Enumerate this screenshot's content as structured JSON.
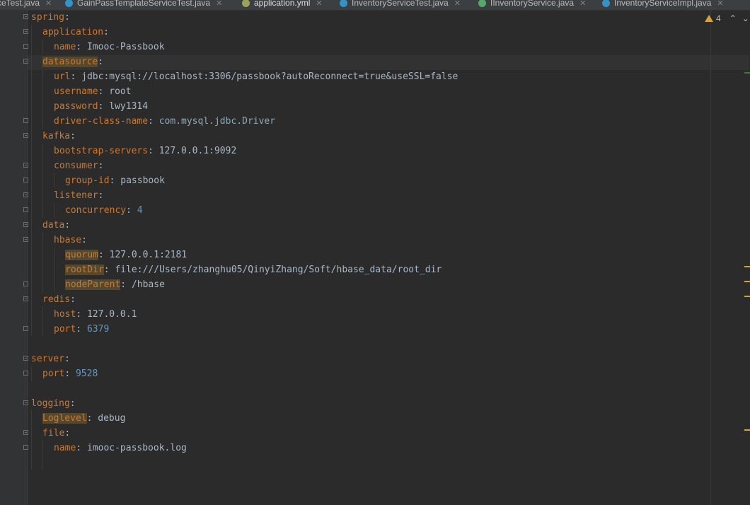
{
  "tabs": [
    {
      "label": "ceTest.java",
      "icon": "class-icon",
      "active": false
    },
    {
      "label": "GainPassTemplateServiceTest.java",
      "icon": "class-icon",
      "active": false
    },
    {
      "label": "application.yml",
      "icon": "yaml-icon",
      "active": true
    },
    {
      "label": "InventoryServiceTest.java",
      "icon": "class-icon",
      "active": false
    },
    {
      "label": "IInventoryService.java",
      "icon": "interface-icon",
      "active": false
    },
    {
      "label": "InventoryServiceImpl.java",
      "icon": "class-icon",
      "active": false
    }
  ],
  "inspection": {
    "count": "4",
    "up": "^",
    "down": "v"
  },
  "code": {
    "l1": {
      "k": "spring",
      "s": ":"
    },
    "l2": {
      "k": "application",
      "s": ":"
    },
    "l3": {
      "k": "name",
      "s": ": ",
      "v": "Imooc-Passbook"
    },
    "l4": {
      "k": "datasource",
      "s": ":"
    },
    "l5": {
      "k": "url",
      "s": ": ",
      "v": "jdbc:mysql://localhost:3306/passbook?autoReconnect=true&useSSL=false"
    },
    "l6": {
      "k": "username",
      "s": ": ",
      "v": "root"
    },
    "l7": {
      "k": "password",
      "s": ": ",
      "v": "lwy1314"
    },
    "l8": {
      "k": "driver-class-name",
      "s": ": ",
      "v": "com.mysql.jdbc.Driver"
    },
    "l9": {
      "k": "kafka",
      "s": ":"
    },
    "l10": {
      "k": "bootstrap-servers",
      "s": ": ",
      "v": "127.0.0.1:9092"
    },
    "l11": {
      "k": "consumer",
      "s": ":"
    },
    "l12": {
      "k": "group-id",
      "s": ": ",
      "v": "passbook"
    },
    "l13": {
      "k": "listener",
      "s": ":"
    },
    "l14": {
      "k": "concurrency",
      "s": ": ",
      "v": "4"
    },
    "l15": {
      "k": "data",
      "s": ":"
    },
    "l16": {
      "k": "hbase",
      "s": ":"
    },
    "l17": {
      "k": "quorum",
      "s": ": ",
      "v": "127.0.0.1:2181"
    },
    "l18": {
      "k": "rootDir",
      "s": ": ",
      "v": "file:///Users/zhanghu05/QinyiZhang/Soft/hbase_data/root_dir"
    },
    "l19": {
      "k": "nodeParent",
      "s": ": ",
      "v": "/hbase"
    },
    "l20": {
      "k": "redis",
      "s": ":"
    },
    "l21": {
      "k": "host",
      "s": ": ",
      "v": "127.0.0.1"
    },
    "l22": {
      "k": "port",
      "s": ": ",
      "v": "6379"
    },
    "l24": {
      "k": "server",
      "s": ":"
    },
    "l25": {
      "k": "port",
      "s": ": ",
      "v": "9528"
    },
    "l27": {
      "k": "logging",
      "s": ":"
    },
    "l28": {
      "k": "Loglevel",
      "s": ": ",
      "v": "debug"
    },
    "l29": {
      "k": "file",
      "s": ":"
    },
    "l30": {
      "k": "name",
      "s": ": ",
      "v": "imooc-passbook.log"
    }
  },
  "colors": {
    "background": "#2b2b2b",
    "key": "#cc7832",
    "number": "#6897bb",
    "warning": "#d8a23a",
    "active_tab": "#4a88c7"
  }
}
